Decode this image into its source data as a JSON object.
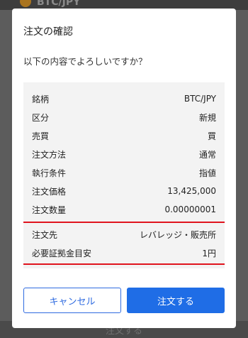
{
  "background": {
    "pair": "BTC/JPY",
    "footer_label": "注文する"
  },
  "dialog": {
    "title": "注文の確認",
    "prompt": "以下の内容でよろしいですか？",
    "rows": [
      {
        "label": "銘柄",
        "value": "BTC/JPY"
      },
      {
        "label": "区分",
        "value": "新規"
      },
      {
        "label": "売買",
        "value": "買"
      },
      {
        "label": "注文方法",
        "value": "通常"
      },
      {
        "label": "執行条件",
        "value": "指値"
      },
      {
        "label": "注文価格",
        "value": "13,425,000"
      },
      {
        "label": "注文数量",
        "value": "0.00000001"
      },
      {
        "label": "注文先",
        "value": "レバレッジ・販売所"
      },
      {
        "label": "必要証拠金目安",
        "value": "1円"
      }
    ],
    "cancel_label": "キャンセル",
    "submit_label": "注文する"
  },
  "colors": {
    "accent": "#1f6de6",
    "highlight_underline": "#e0141e",
    "overlay": "#5c5c5c"
  }
}
